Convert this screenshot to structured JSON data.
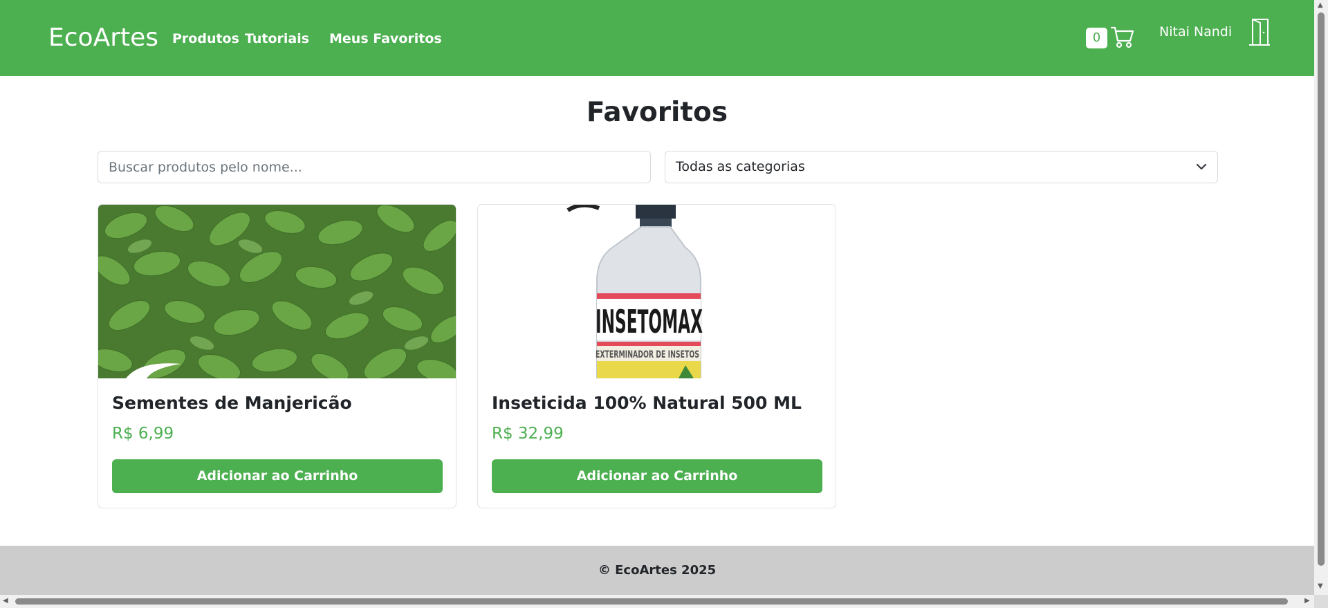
{
  "navbar": {
    "brand": "EcoArtes",
    "links": [
      "Produtos",
      "Tutoriais",
      "Meus Favoritos"
    ],
    "cart_count": "0",
    "user_name": "Nitai Nandi"
  },
  "main": {
    "title": "Favoritos",
    "search_placeholder": "Buscar produtos pelo nome...",
    "category_selected": "Todas as categorias"
  },
  "products": [
    {
      "name": "Sementes de Manjericão",
      "price": "R$ 6,99",
      "button": "Adicionar ao Carrinho"
    },
    {
      "name": "Inseticida 100% Natural 500 ML",
      "price": "R$ 32,99",
      "button": "Adicionar ao Carrinho"
    }
  ],
  "product_label": {
    "brand_line": "INSETOMAX",
    "sub_line": "EXTERMINADOR DE INSETOS"
  },
  "footer": {
    "text": "© EcoArtes 2025"
  },
  "colors": {
    "primary": "#4caf50",
    "footer_bg": "#cccccc"
  }
}
